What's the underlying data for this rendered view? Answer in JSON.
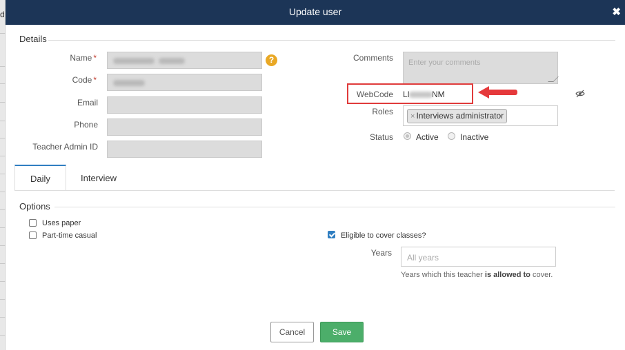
{
  "background": {
    "letter": "d"
  },
  "modal": {
    "title": "Update user"
  },
  "details": {
    "heading": "Details",
    "fields": {
      "name_label": "Name",
      "code_label": "Code",
      "email_label": "Email",
      "phone_label": "Phone",
      "teacher_admin_id_label": "Teacher Admin ID",
      "required_mark": "*",
      "help_glyph": "?"
    },
    "comments": {
      "label": "Comments",
      "placeholder": "Enter your comments"
    },
    "webcode": {
      "label": "WebCode",
      "value_start": "LI",
      "value_end": "NM"
    },
    "roles": {
      "label": "Roles",
      "tags": [
        {
          "label": "Interviews administrator",
          "remove": "×"
        }
      ]
    },
    "status": {
      "label": "Status",
      "options": [
        {
          "label": "Active",
          "selected": true
        },
        {
          "label": "Inactive",
          "selected": false
        }
      ]
    }
  },
  "tabs": [
    {
      "label": "Daily",
      "active": true
    },
    {
      "label": "Interview",
      "active": false
    }
  ],
  "options": {
    "heading": "Options",
    "uses_paper": {
      "label": "Uses paper",
      "checked": false
    },
    "part_time_casual": {
      "label": "Part-time casual",
      "checked": false
    },
    "eligible_to_cover": {
      "label": "Eligible to cover classes?",
      "checked": true
    },
    "years": {
      "label": "Years",
      "placeholder": "All years",
      "help_prefix": "Years which this teacher ",
      "help_bold": "is allowed to",
      "help_suffix": " cover."
    }
  },
  "buttons": {
    "cancel": "Cancel",
    "save": "Save"
  },
  "colors": {
    "header_bg": "#1c3557",
    "accent": "#2f7ec1",
    "save_green": "#4cae6a",
    "highlight_red": "#e03b3b",
    "help_orange": "#e9a825"
  },
  "icons": {
    "close": "close-icon",
    "help": "help-icon",
    "eye_off": "eye-off-icon",
    "annotation_arrow": "arrow-left-icon"
  }
}
